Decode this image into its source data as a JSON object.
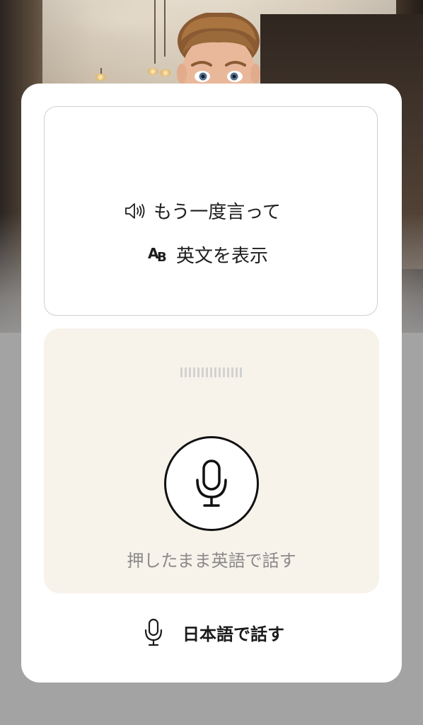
{
  "prompt": {
    "repeat_label": "もう一度言って",
    "show_english_label": "英文を表示",
    "show_english_icon_text": "AB"
  },
  "record": {
    "hint": "押したまま英語で話す",
    "level_ticks": 15
  },
  "japanese": {
    "label": "日本語で話す"
  },
  "colors": {
    "card": "#ffffff",
    "record_panel": "#f7f2ea",
    "overlay": "#a3a3a3",
    "text": "#1d1d1d",
    "hint": "#8a8a8a"
  },
  "icons": [
    "speaker-icon",
    "ab-translate-icon",
    "microphone-icon"
  ]
}
